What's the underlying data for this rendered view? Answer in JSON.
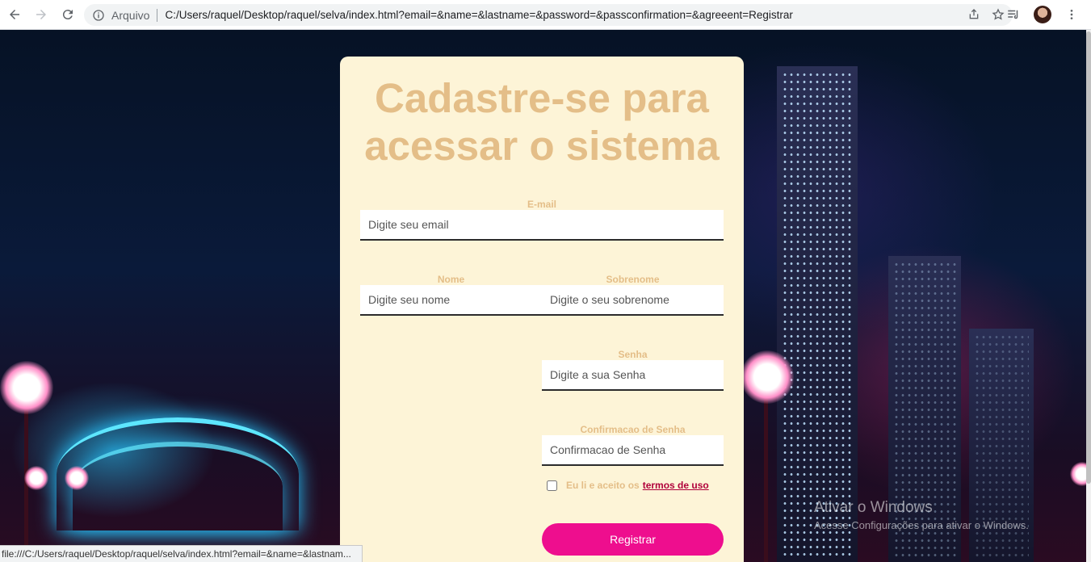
{
  "browser": {
    "scheme_label": "Arquivo",
    "url": "C:/Users/raquel/Desktop/raquel/selva/index.html?email=&name=&lastname=&password=&passconfirmation=&agreeent=Registrar",
    "status_url": "file:///C:/Users/raquel/Desktop/raquel/selva/index.html?email=&name=&lastnam..."
  },
  "form": {
    "title": "Cadastre-se para acessar o sistema",
    "email": {
      "label": "E-mail",
      "placeholder": "Digite seu email"
    },
    "name": {
      "label": "Nome",
      "placeholder": "Digite seu nome"
    },
    "lastname": {
      "label": "Sobrenome",
      "placeholder": "Digite o seu sobrenome"
    },
    "password": {
      "label": "Senha",
      "placeholder": "Digite a sua Senha"
    },
    "passconfirmation": {
      "label": "Confirmacao de Senha",
      "placeholder": "Confirmacao de Senha"
    },
    "agree_text": "Eu li e aceito os",
    "terms_link": "termos de uso",
    "submit_label": "Registrar"
  },
  "watermark": {
    "line1": "Ativar o Windows",
    "line2": "Acesse Configurações para ativar o Windows."
  },
  "colors": {
    "card_bg": "#fdf4d7",
    "label": "#e4be88",
    "button": "#ee0e8e",
    "terms_link": "#b0003a"
  }
}
